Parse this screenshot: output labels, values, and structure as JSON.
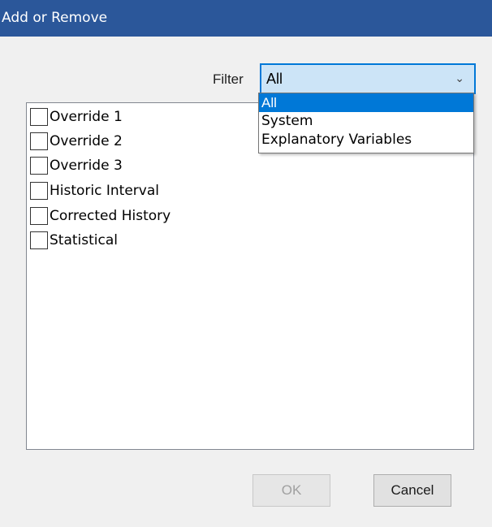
{
  "window": {
    "title": "Add or Remove"
  },
  "filter": {
    "label": "Filter",
    "selected": "All",
    "options": [
      "All",
      "System",
      "Explanatory Variables"
    ]
  },
  "list": {
    "items": [
      {
        "label": "Override 1",
        "checked": false
      },
      {
        "label": "Override 2",
        "checked": false
      },
      {
        "label": "Override 3",
        "checked": false
      },
      {
        "label": "Historic Interval",
        "checked": false
      },
      {
        "label": "Corrected History",
        "checked": false
      },
      {
        "label": "Statistical",
        "checked": false
      }
    ]
  },
  "buttons": {
    "ok_label": "OK",
    "cancel_label": "Cancel"
  },
  "icons": {
    "dropdown": "chevron-down-icon"
  },
  "colors": {
    "titlebar": "#2b579a",
    "accent": "#0078d7",
    "select_bg": "#cce4f7"
  }
}
